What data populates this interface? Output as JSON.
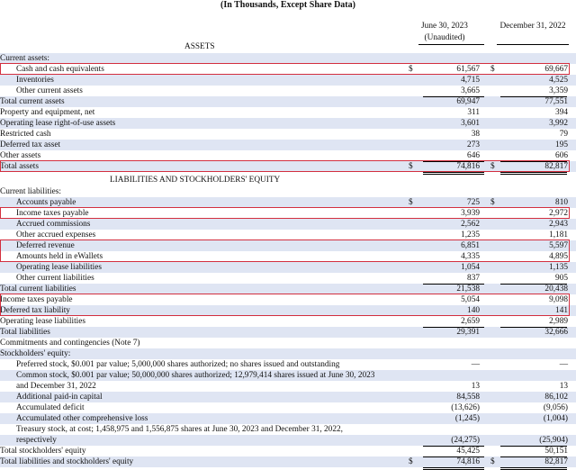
{
  "caption": "(In Thousands, Except Share Data)",
  "columns": {
    "col1_line1": "June 30, 2023",
    "col1_line2": "(Unaudited)",
    "col2_line1": "December 31, 2022"
  },
  "sections": {
    "assets": "ASSETS",
    "liabilities": "LIABILITIES AND STOCKHOLDERS' EQUITY"
  },
  "rows": [
    {
      "label": "Current assets:",
      "indent": 0,
      "v1": "",
      "v2": ""
    },
    {
      "label": "Cash and cash equivalents",
      "indent": 1,
      "d1": "$",
      "v1": "61,567",
      "d2": "$",
      "v2": "69,667"
    },
    {
      "label": "Inventories",
      "indent": 1,
      "v1": "4,715",
      "v2": "4,525"
    },
    {
      "label": "Other current assets",
      "indent": 1,
      "v1": "3,665",
      "v2": "3,359"
    },
    {
      "label": "Total current assets",
      "indent": 0,
      "v1": "69,947",
      "v2": "77,551"
    },
    {
      "label": "Property and equipment, net",
      "indent": 0,
      "v1": "311",
      "v2": "394"
    },
    {
      "label": "Operating lease right-of-use assets",
      "indent": 0,
      "v1": "3,601",
      "v2": "3,992"
    },
    {
      "label": "Restricted cash",
      "indent": 0,
      "v1": "38",
      "v2": "79"
    },
    {
      "label": "Deferred tax asset",
      "indent": 0,
      "v1": "273",
      "v2": "195"
    },
    {
      "label": "Other assets",
      "indent": 0,
      "v1": "646",
      "v2": "606"
    },
    {
      "label": "Total assets",
      "indent": 0,
      "d1": "$",
      "v1": "74,816",
      "d2": "$",
      "v2": "82,817"
    },
    {
      "label": "Current liabilities:",
      "indent": 0,
      "v1": "",
      "v2": ""
    },
    {
      "label": "Accounts payable",
      "indent": 1,
      "d1": "$",
      "v1": "725",
      "d2": "$",
      "v2": "810"
    },
    {
      "label": "Income taxes payable",
      "indent": 1,
      "v1": "3,939",
      "v2": "2,972"
    },
    {
      "label": "Accrued commissions",
      "indent": 1,
      "v1": "2,562",
      "v2": "2,943"
    },
    {
      "label": "Other accrued expenses",
      "indent": 1,
      "v1": "1,235",
      "v2": "1,181"
    },
    {
      "label": "Deferred revenue",
      "indent": 1,
      "v1": "6,851",
      "v2": "5,597"
    },
    {
      "label": "Amounts held in eWallets",
      "indent": 1,
      "v1": "4,335",
      "v2": "4,895"
    },
    {
      "label": "Operating lease liabilities",
      "indent": 1,
      "v1": "1,054",
      "v2": "1,135"
    },
    {
      "label": "Other current liabilities",
      "indent": 1,
      "v1": "837",
      "v2": "905"
    },
    {
      "label": "Total current liabilities",
      "indent": 0,
      "v1": "21,538",
      "v2": "20,438"
    },
    {
      "label": "Income taxes payable",
      "indent": 0,
      "v1": "5,054",
      "v2": "9,098"
    },
    {
      "label": "Deferred tax liability",
      "indent": 0,
      "v1": "140",
      "v2": "141"
    },
    {
      "label": "Operating lease liabilities",
      "indent": 0,
      "v1": "2,659",
      "v2": "2,989"
    },
    {
      "label": "Total liabilities",
      "indent": 0,
      "v1": "29,391",
      "v2": "32,666"
    },
    {
      "label": "Commitments and contingencies (Note 7)",
      "indent": 0,
      "v1": "",
      "v2": ""
    },
    {
      "label": "Stockholders' equity:",
      "indent": 0,
      "v1": "",
      "v2": ""
    },
    {
      "label": "Preferred stock, $0.001 par value; 5,000,000 shares authorized; no shares issued and outstanding",
      "indent": 1,
      "v1": "—",
      "v2": "—"
    },
    {
      "label": "Common stock, $0.001 par value; 50,000,000 shares authorized; 12,979,414 shares issued at June 30, 2023",
      "indent": 1,
      "v1": "",
      "v2": ""
    },
    {
      "label": "and December 31, 2022",
      "indent": 1,
      "v1": "13",
      "v2": "13"
    },
    {
      "label": "Additional paid-in capital",
      "indent": 1,
      "v1": "84,558",
      "v2": "86,102"
    },
    {
      "label": "Accumulated deficit",
      "indent": 1,
      "v1": "(13,626)",
      "v2": "(9,056)"
    },
    {
      "label": "Accumulated other comprehensive loss",
      "indent": 1,
      "v1": "(1,245)",
      "v2": "(1,004)"
    },
    {
      "label": "Treasury stock, at cost; 1,458,975 and 1,556,875 shares at June 30, 2023 and December 31, 2022,",
      "indent": 1,
      "v1": "",
      "v2": ""
    },
    {
      "label": "respectively",
      "indent": 1,
      "v1": "(24,275)",
      "v2": "(25,904)"
    },
    {
      "label": "Total stockholders' equity",
      "indent": 0,
      "v1": "45,425",
      "v2": "50,151"
    },
    {
      "label": "Total liabilities and stockholders' equity",
      "indent": 0,
      "d1": "$",
      "v1": "74,816",
      "d2": "$",
      "v2": "82,817"
    }
  ],
  "colors": {
    "shading": "#dfe5f3",
    "highlight": "#d32f3f"
  }
}
